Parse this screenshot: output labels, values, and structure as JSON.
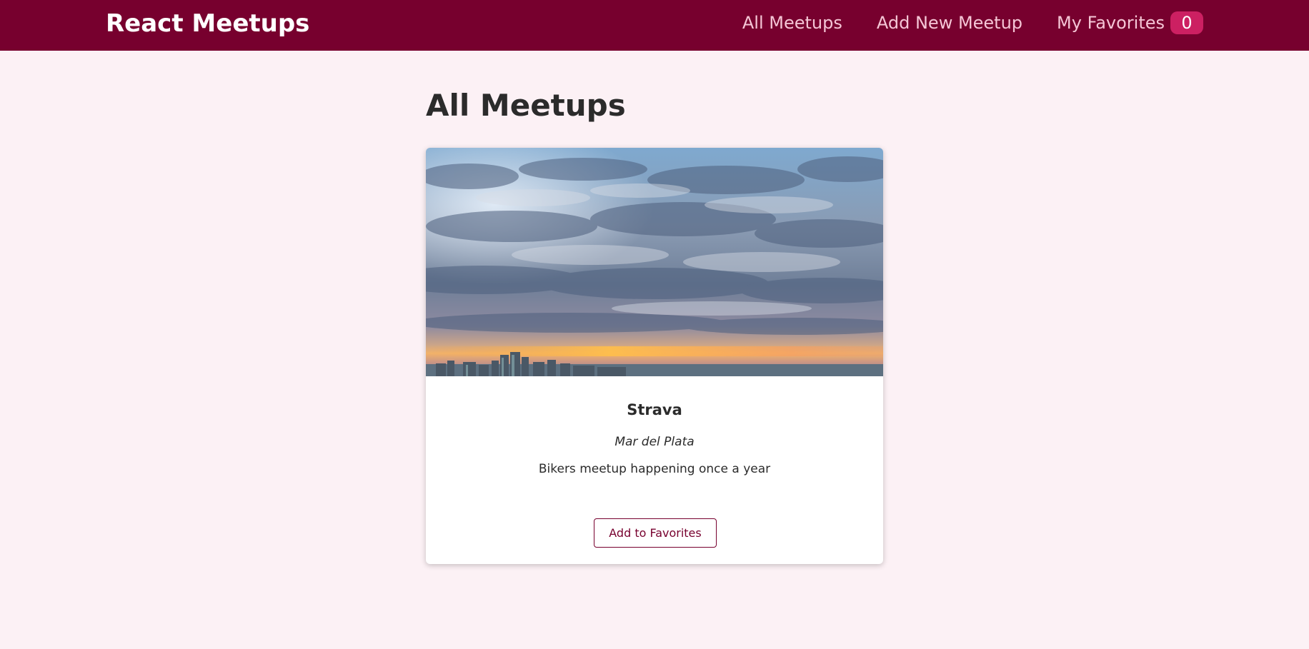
{
  "header": {
    "logo": "React Meetups",
    "nav": [
      {
        "label": "All Meetups"
      },
      {
        "label": "Add New Meetup"
      },
      {
        "label": "My Favorites"
      }
    ],
    "favorites_count": "0"
  },
  "main": {
    "title": "All Meetups",
    "meetups": [
      {
        "title": "Strava",
        "address": "Mar del Plata",
        "description": "Bikers meetup happening once a year",
        "button_label": "Add to Favorites",
        "image": "cloudy-sky-city-skyline-photo"
      }
    ]
  },
  "colors": {
    "header_bg": "#77002e",
    "page_bg": "#fcf1f5",
    "badge_bg": "#cc2062",
    "accent": "#77002e"
  }
}
